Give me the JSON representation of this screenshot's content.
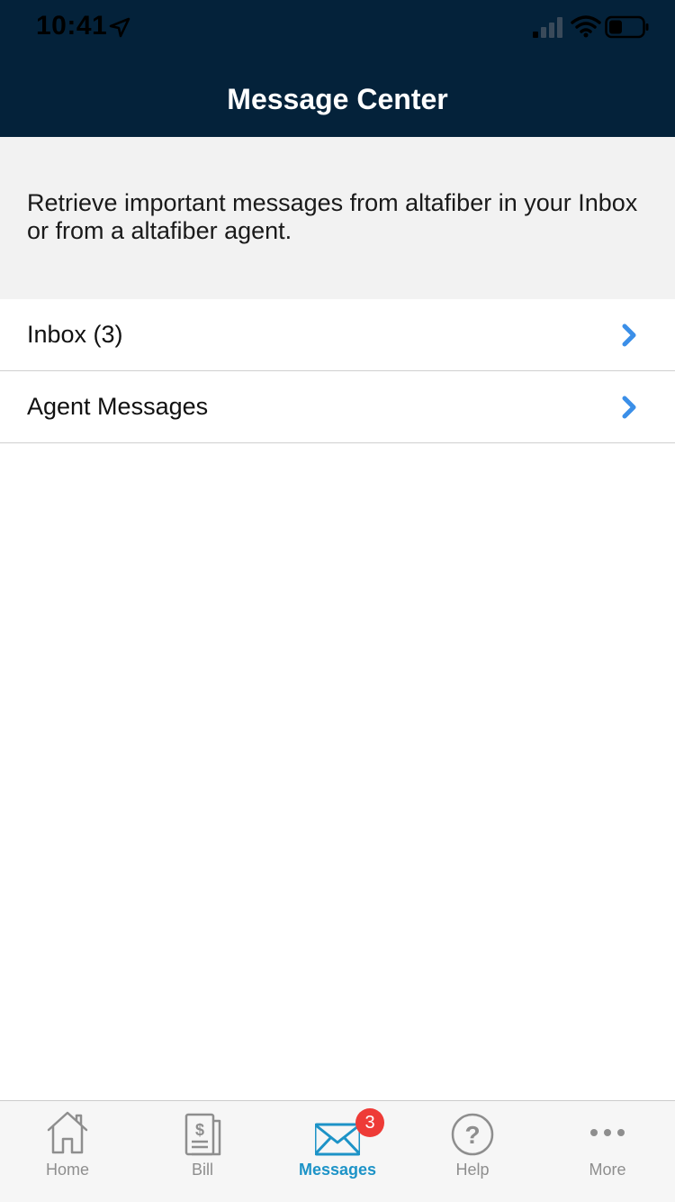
{
  "status_bar": {
    "time": "10:41"
  },
  "header": {
    "title": "Message Center",
    "background_color": "#04223a"
  },
  "intro": {
    "text": "Retrieve important messages from altafiber in your Inbox or from a altafiber agent."
  },
  "list": {
    "items": [
      {
        "label": "Inbox (3)",
        "icon": "chevron-right-icon"
      },
      {
        "label": "Agent Messages",
        "icon": "chevron-right-icon"
      }
    ],
    "chevron_color": "#3b8fe8"
  },
  "tab_bar": {
    "tabs": [
      {
        "label": "Home",
        "icon": "home-icon",
        "active": false
      },
      {
        "label": "Bill",
        "icon": "bill-icon",
        "active": false
      },
      {
        "label": "Messages",
        "icon": "envelope-icon",
        "active": true,
        "badge": "3"
      },
      {
        "label": "Help",
        "icon": "help-icon",
        "active": false
      },
      {
        "label": "More",
        "icon": "more-icon",
        "active": false
      }
    ],
    "active_color": "#1d93c7",
    "inactive_color": "#8e8e8e",
    "badge_color": "#ee3b37"
  }
}
